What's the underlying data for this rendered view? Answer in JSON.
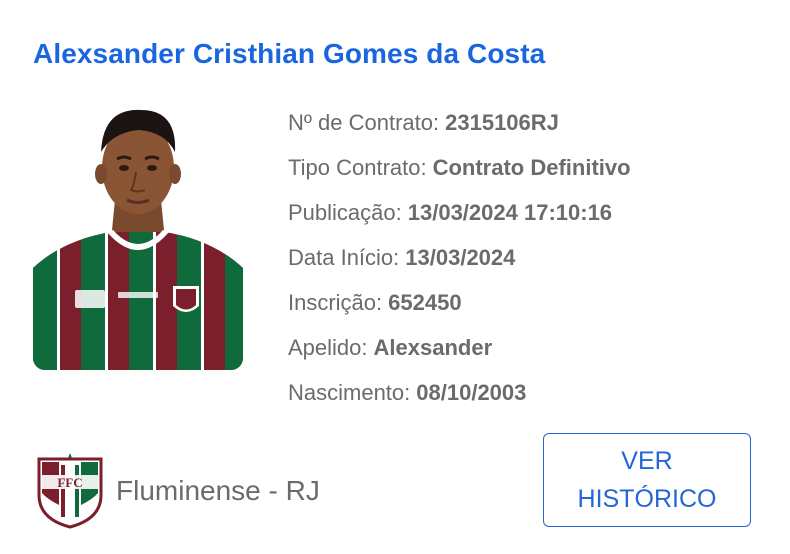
{
  "player": {
    "name": "Alexsander Cristhian Gomes da Costa",
    "photo_icon": "player-photo"
  },
  "details": [
    {
      "label": "Nº de Contrato:",
      "value": "2315106RJ"
    },
    {
      "label": "Tipo Contrato:",
      "value": "Contrato Definitivo"
    },
    {
      "label": "Publicação:",
      "value": "13/03/2024 17:10:16"
    },
    {
      "label": "Data Início:",
      "value": "13/03/2024"
    },
    {
      "label": "Inscrição:",
      "value": "652450"
    },
    {
      "label": "Apelido:",
      "value": "Alexsander"
    },
    {
      "label": "Nascimento:",
      "value": "08/10/2003"
    }
  ],
  "club": {
    "name": "Fluminense - RJ",
    "crest_icon": "fluminense-crest-icon",
    "crest_monogram": "FFC"
  },
  "actions": {
    "history_line1": "VER",
    "history_line2": "HISTÓRICO"
  },
  "colors": {
    "title": "#1a66e0",
    "text": "#6b6b6b",
    "button": "#2466d6",
    "club_green": "#0f6b3b",
    "club_maroon": "#7a1f2b"
  }
}
